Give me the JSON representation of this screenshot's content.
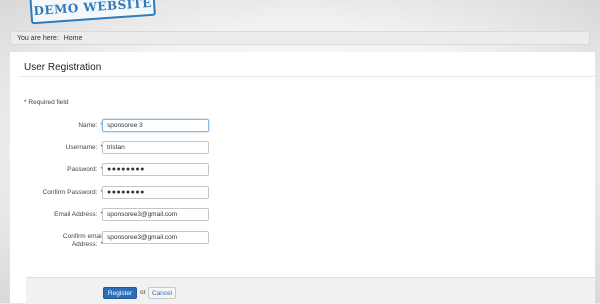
{
  "logo": {
    "text": "DEMO WEBSITE"
  },
  "breadcrumb": {
    "prefix": "You are here:",
    "current": "Home"
  },
  "page": {
    "title": "User Registration",
    "required_note": "* Required field"
  },
  "form": {
    "fields": [
      {
        "label": "Name:",
        "required": "*",
        "value": "sponsoree 3"
      },
      {
        "label": "Username:",
        "required": "*",
        "value": "tristan"
      },
      {
        "label": "Password:",
        "required": "*",
        "value": "●●●●●●●●"
      },
      {
        "label": "Confirm Password:",
        "required": "*",
        "value": "●●●●●●●●"
      },
      {
        "label": "Email Address:",
        "required": "*",
        "value": "sponsoree3@gmail.com"
      },
      {
        "label": "Confirm email",
        "label_line2": "Address:",
        "required": "*",
        "value": "sponsoree3@gmail.com"
      }
    ]
  },
  "actions": {
    "register_label": "Register",
    "or_text": "or",
    "cancel_label": "Cancel"
  },
  "colors": {
    "accent": "#2d6fb7",
    "logo": "#2f7ab9"
  }
}
